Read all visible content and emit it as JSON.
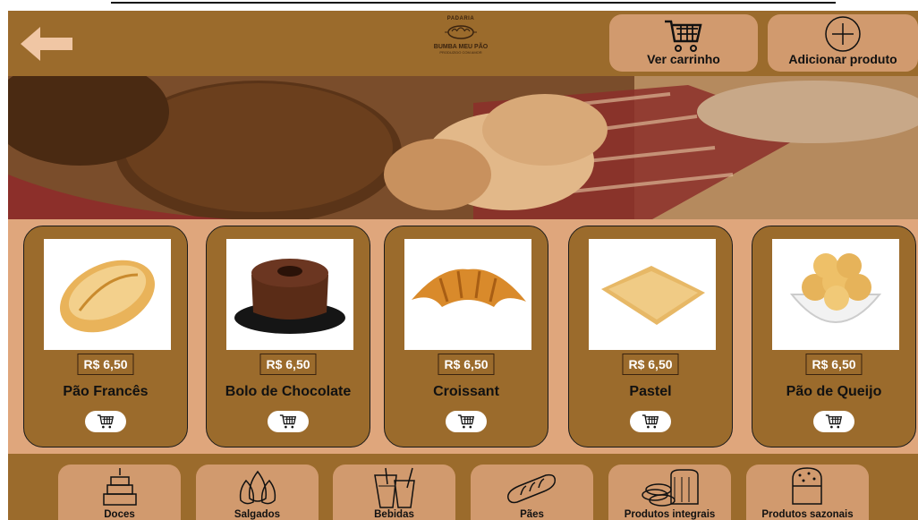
{
  "header": {
    "back_icon": "arrow-left-icon",
    "logo": {
      "line1": "PADARIA",
      "line2": "BUMBA MEU PÃO",
      "line3": "PRODUZIDO COM AMOR"
    },
    "cart_button": {
      "label": "Ver carrinho",
      "icon": "shopping-cart-icon"
    },
    "add_button": {
      "label": "Adicionar produto",
      "icon": "plus-circle-icon"
    }
  },
  "products": [
    {
      "name": "Pão Francês",
      "price": "R$ 6,50",
      "image": "french-bread-photo"
    },
    {
      "name": "Bolo de Chocolate",
      "price": "R$ 6,50",
      "image": "chocolate-cake-photo"
    },
    {
      "name": "Croissant",
      "price": "R$ 6,50",
      "image": "croissant-photo"
    },
    {
      "name": "Pastel",
      "price": "R$ 6,50",
      "image": "pastel-photo"
    },
    {
      "name": "Pão de Queijo",
      "price": "R$ 6,50",
      "image": "cheese-bread-photo"
    }
  ],
  "categories": [
    {
      "label": "Doces",
      "icon": "cake-icon"
    },
    {
      "label": "Salgados",
      "icon": "coxinha-icon"
    },
    {
      "label": "Bebidas",
      "icon": "drinks-icon"
    },
    {
      "label": "Pães",
      "icon": "baguette-icon"
    },
    {
      "label": "Produtos integrais",
      "icon": "whole-bread-icon"
    },
    {
      "label": "Produtos sazonais",
      "icon": "panettone-icon"
    }
  ],
  "colors": {
    "header_brown": "#9b6b2c",
    "button_tan": "#d19a6e",
    "products_bg": "#dfa67c",
    "arrow": "#f0c6a4"
  }
}
